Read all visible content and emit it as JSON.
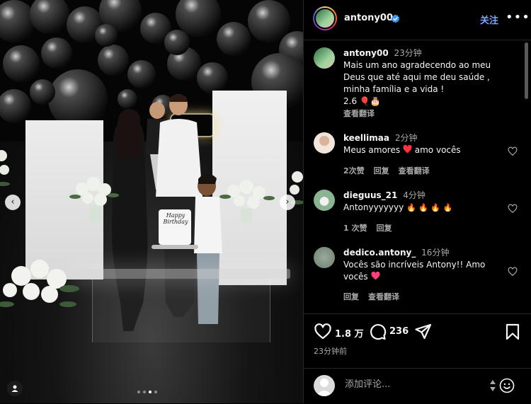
{
  "post": {
    "username": "antony00",
    "follow_label": "关注",
    "more_label": "•••",
    "caption": {
      "username": "antony00",
      "time": "23分钟",
      "text": "Mais um ano agradecendo ao meu Deus que até aqui me deu saúde , minha família e a vida !",
      "date_line": "2.6",
      "emojis": "🎈🎂",
      "translate": "查看翻译"
    },
    "comments": [
      {
        "username": "keellimaa",
        "time": "2分钟",
        "text": "Meus amores",
        "text_after": "amo vocês",
        "likes": "2次赞",
        "reply": "回复",
        "translate": "查看翻译"
      },
      {
        "username": "dieguus_21",
        "time": "4分钟",
        "text": "Antonyyyyyyy",
        "flames": "🔥 🔥 🔥 🔥",
        "likes": "1 次赞",
        "reply": "回复"
      },
      {
        "username": "dedico.antony_",
        "time": "16分钟",
        "text": "Vocês são incríveis Antony!! Amo vocês",
        "reply": "回复",
        "translate": "查看翻译"
      }
    ],
    "likes_count": "1.8 万",
    "comments_count": "236",
    "posted_ago": "23分钟前",
    "composer_placeholder": "添加评论...",
    "photo": {
      "cake_text": "Happy Birthday",
      "carousel_total": 4,
      "carousel_active": 3
    },
    "colors": {
      "follow": "#7aa8ff",
      "verified": "#3897f0",
      "heart": "#ff3040"
    },
    "icons": [
      "heart-icon",
      "comment-icon",
      "share-icon",
      "bookmark-icon",
      "emoji-icon",
      "verified-icon",
      "user-tag-icon"
    ]
  }
}
